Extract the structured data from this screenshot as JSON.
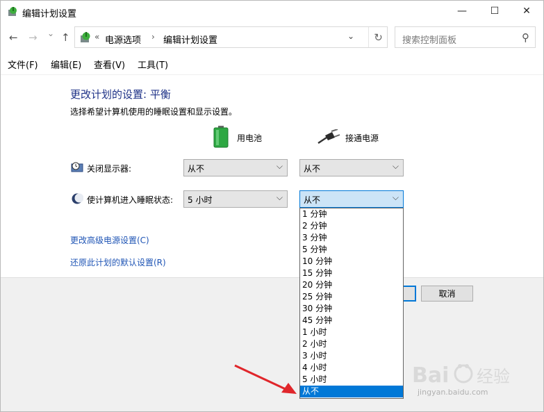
{
  "window": {
    "title": "编辑计划设置"
  },
  "titlebar": {
    "minimize": "—",
    "maximize": "☐",
    "close": "✕"
  },
  "nav": {
    "back": "←",
    "forward": "→",
    "recent": "⌄",
    "up": "↑",
    "breadcrumb_prefix": "«",
    "crumb1": "电源选项",
    "crumb_sep": "›",
    "crumb2": "编辑计划设置",
    "dropdown": "⌄",
    "refresh": "↻"
  },
  "search": {
    "placeholder": "搜索控制面板",
    "icon": "⚲"
  },
  "menu": {
    "file": "文件(F)",
    "edit": "编辑(E)",
    "view": "查看(V)",
    "tools": "工具(T)"
  },
  "main": {
    "heading": "更改计划的设置: 平衡",
    "subtext": "选择希望计算机使用的睡眠设置和显示设置。",
    "battery_label": "用电池",
    "plugged_label": "接通电源",
    "rows": [
      {
        "label": "关闭显示器:",
        "battery_value": "从不",
        "plugged_value": "从不"
      },
      {
        "label": "使计算机进入睡眠状态:",
        "battery_value": "5 小时",
        "plugged_value": "从不"
      }
    ],
    "chevron": "⌵",
    "link_advanced": "更改高级电源设置(C)",
    "link_restore": "还原此计划的默认设置(R)"
  },
  "buttons": {
    "cancel": "取消"
  },
  "dropdown": {
    "options": [
      "1 分钟",
      "2 分钟",
      "3 分钟",
      "5 分钟",
      "10 分钟",
      "15 分钟",
      "20 分钟",
      "25 分钟",
      "30 分钟",
      "45 分钟",
      "1 小时",
      "2 小时",
      "3 小时",
      "4 小时",
      "5 小时",
      "从不"
    ],
    "selected_index": 15
  },
  "watermark": {
    "line1": "Bai",
    "line2": "经验",
    "url": "jingyan.baidu.com"
  },
  "colors": {
    "accent": "#0078d7",
    "heading": "#1e3287",
    "link": "#1f55b5",
    "arrow": "#e0262b"
  }
}
